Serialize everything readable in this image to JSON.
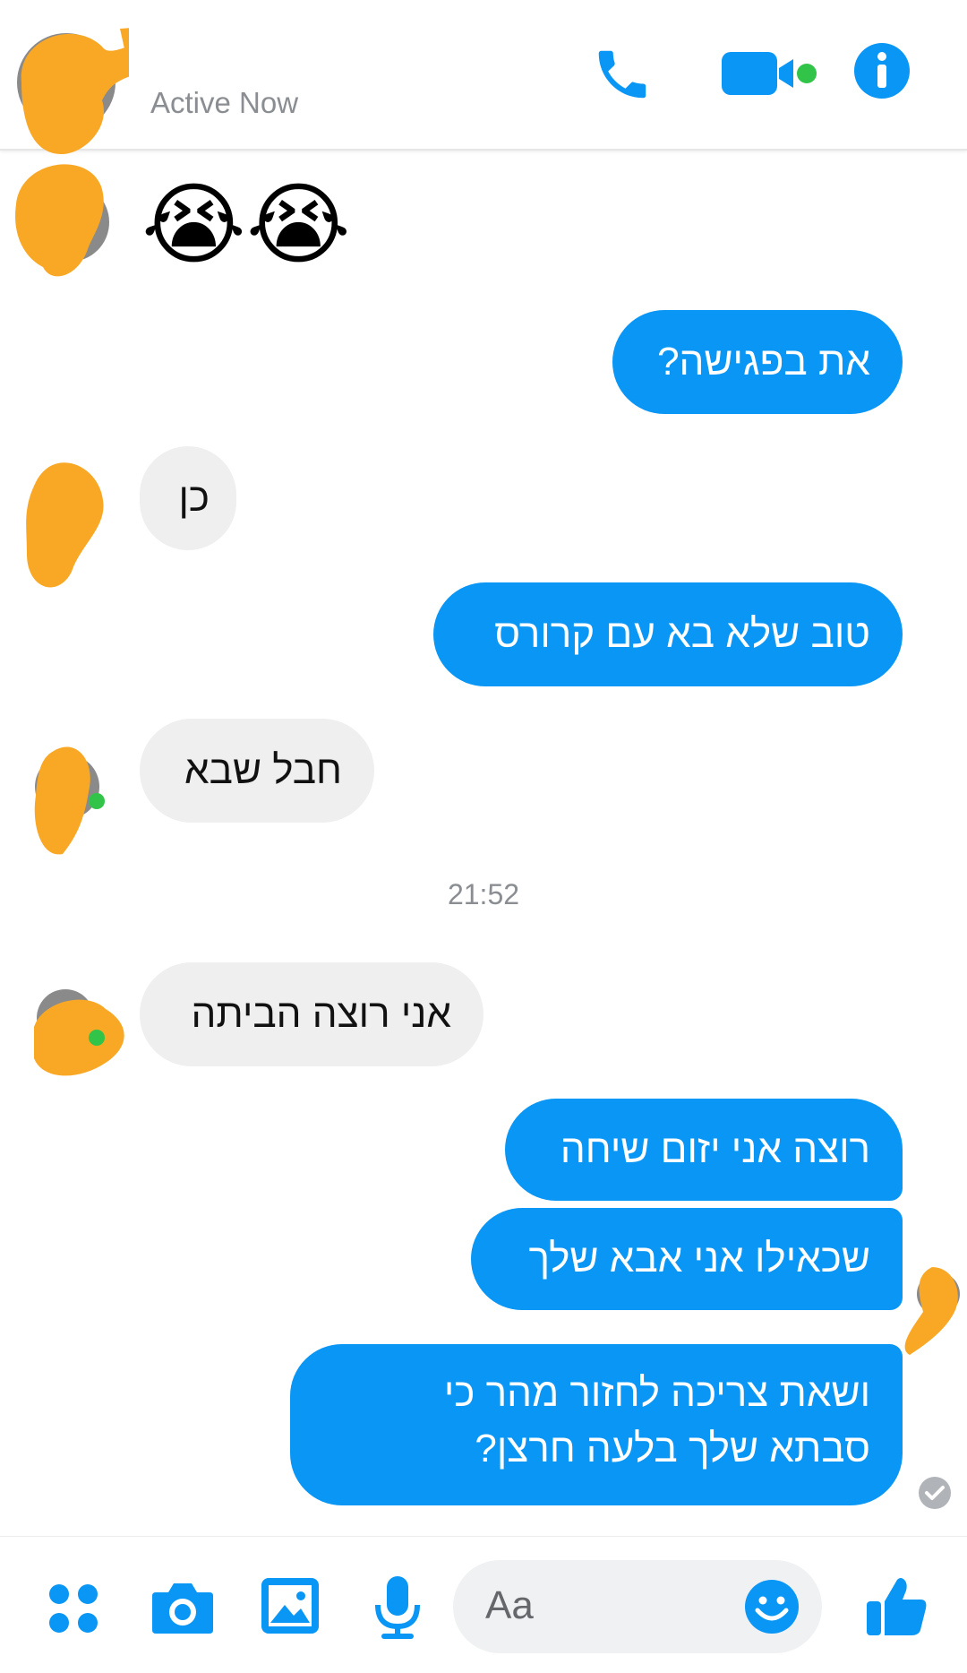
{
  "header": {
    "status": "Active Now"
  },
  "icons": {
    "phone": "phone-icon",
    "video": "video-camera-icon",
    "info": "info-icon",
    "apps": "apps-grid-icon",
    "camera": "camera-icon",
    "gallery": "image-gallery-icon",
    "mic": "microphone-icon",
    "emoji": "smiley-icon",
    "like": "thumbs-up-icon"
  },
  "colors": {
    "accent": "#0a96f5",
    "incoming_bubble": "#efefef",
    "online": "#31c449",
    "redaction": "#f9a825"
  },
  "messages": {
    "emoji_reaction": "😭😭",
    "m1": "את בפגישה?",
    "m2": "כן",
    "m3": "טוב שלא בא עם קרורס",
    "m4": "חבל שבא",
    "time": "21:52",
    "m5": "אני רוצה הביתה",
    "m6": "רוצה אני יזום שיחה",
    "m7": "שכאילו אני אבא שלך",
    "m8_line1": "ושאת צריכה לחזור מהר כי",
    "m8_line2": "סבתא שלך בלעה חרצן?"
  },
  "composer": {
    "placeholder": "Aa"
  }
}
